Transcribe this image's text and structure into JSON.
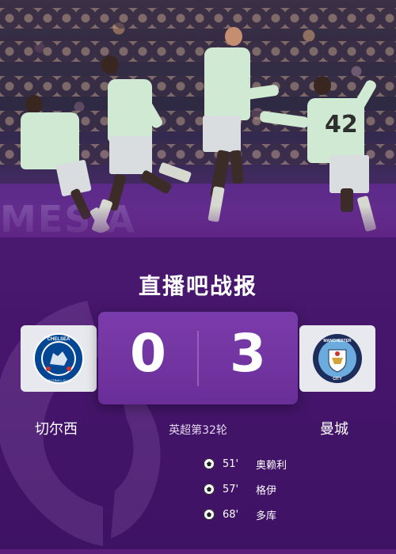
{
  "banner": {
    "watermark_text": "MES A"
  },
  "brand": {
    "title_left": "直播吧战",
    "title_right": "报"
  },
  "match": {
    "home": {
      "name": "切尔西",
      "score": "0",
      "crest_text": "CHELSEA",
      "crest_sub": "FOOTBALL CLUB",
      "crest_color": "#034694"
    },
    "away": {
      "name": "曼城",
      "score": "3",
      "crest_text": "MANCHESTER",
      "crest_sub": "CITY",
      "crest_color": "#6cabdd"
    },
    "round": "英超第32轮"
  },
  "player_number": "42",
  "goals": [
    {
      "minute": "51'",
      "scorer": "奥赖利",
      "icon": "soccer-ball-icon"
    },
    {
      "minute": "57'",
      "scorer": "格伊",
      "icon": "soccer-ball-icon"
    },
    {
      "minute": "68'",
      "scorer": "多库",
      "icon": "soccer-ball-icon"
    }
  ],
  "colors": {
    "background": "#5a1f7a",
    "score_panel": "#7b3cab",
    "crest_box": "#e8e9ee"
  }
}
